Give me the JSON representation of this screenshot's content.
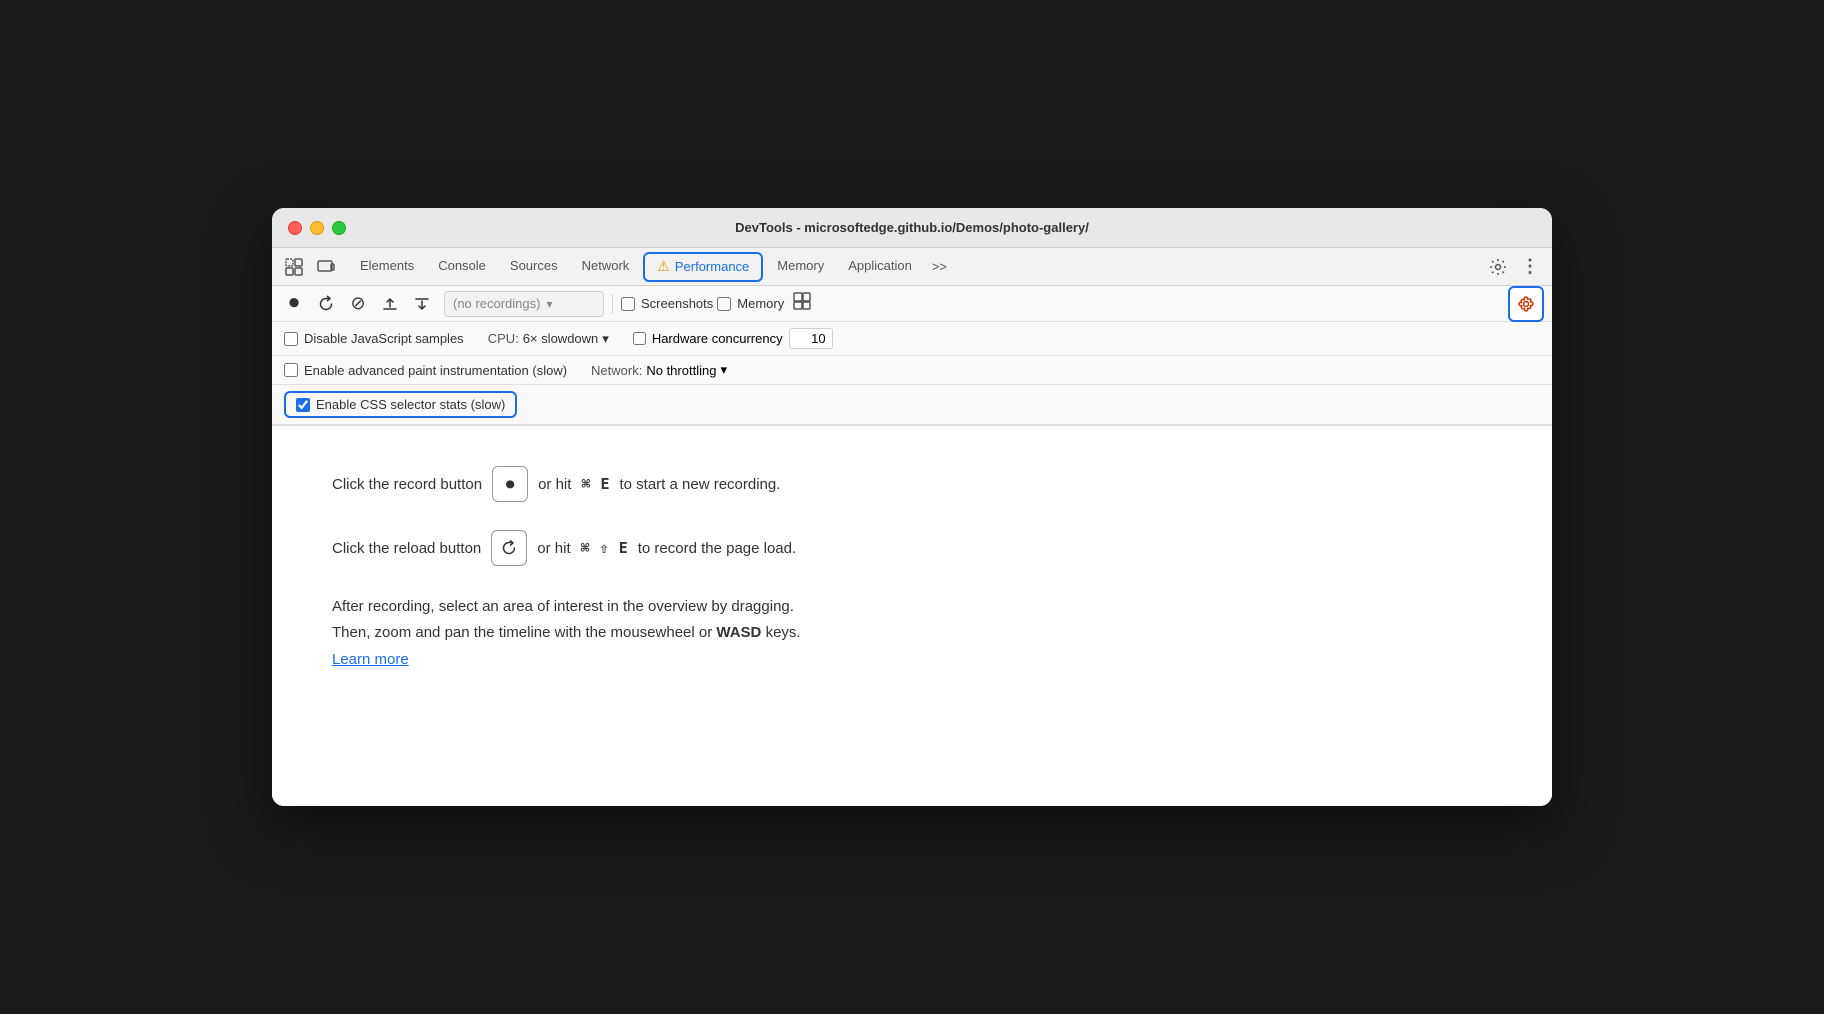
{
  "window": {
    "title": "DevTools - microsoftedge.github.io/Demos/photo-gallery/"
  },
  "tabs": {
    "items": [
      {
        "label": "Elements",
        "active": false
      },
      {
        "label": "Console",
        "active": false
      },
      {
        "label": "Sources",
        "active": false
      },
      {
        "label": "Network",
        "active": false
      },
      {
        "label": "Performance",
        "active": true,
        "warning": true
      },
      {
        "label": "Memory",
        "active": false
      },
      {
        "label": "Application",
        "active": false
      }
    ],
    "more_label": ">>",
    "settings_label": "⚙",
    "dots_label": "⋮"
  },
  "toolbar": {
    "record_title": "Record",
    "reload_title": "Reload and record",
    "clear_title": "Clear recording",
    "upload_title": "Load profile",
    "download_title": "Save profile",
    "recording_placeholder": "(no recordings)",
    "screenshots_label": "Screenshots",
    "memory_label": "Memory",
    "paint_icon_title": "Paint flashing"
  },
  "options": {
    "disable_js_samples_label": "Disable JavaScript samples",
    "disable_js_samples_checked": false,
    "enable_advanced_paint_label": "Enable advanced paint instrumentation (slow)",
    "enable_advanced_paint_checked": false,
    "enable_css_selector_label": "Enable CSS selector stats (slow)",
    "enable_css_selector_checked": true,
    "cpu_label": "CPU:",
    "cpu_value": "6× slowdown",
    "network_label": "Network:",
    "network_value": "No throttling",
    "hardware_concurrency_label": "Hardware concurrency",
    "hardware_concurrency_checked": false,
    "hardware_concurrency_value": "10"
  },
  "instructions": {
    "record_instruction": "Click the record button",
    "record_shortcut": "⌘ E",
    "record_suffix": "to start a new recording.",
    "reload_instruction": "Click the reload button",
    "reload_shortcut": "⌘ ⇧ E",
    "reload_suffix": "to record the page load.",
    "after_line1": "After recording, select an area of interest in the overview by dragging.",
    "after_line2": "Then, zoom and pan the timeline with the mousewheel or",
    "after_bold": "WASD",
    "after_end": "keys.",
    "learn_more_label": "Learn more"
  },
  "colors": {
    "active_tab_blue": "#1a6fe8",
    "warning_orange": "#e8a000",
    "settings_gear_color": "#cc3300"
  }
}
